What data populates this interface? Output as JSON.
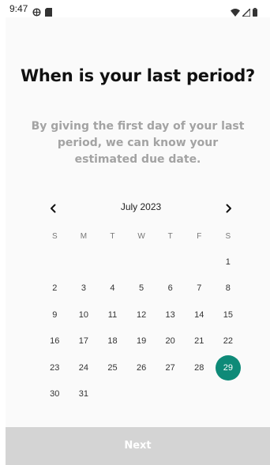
{
  "status_bar": {
    "time": "9:47",
    "left_icons": [
      "vpn-globe-icon",
      "sd-card-icon"
    ],
    "right_icons": [
      "wifi-icon",
      "cell-signal-icon",
      "battery-icon"
    ]
  },
  "onboarding": {
    "title": "When is your last period?",
    "subtitle": "By giving the first day of your last period, we can know your estimated due date."
  },
  "calendar": {
    "month_label": "July 2023",
    "prev_icon": "chevron-left-icon",
    "next_icon": "chevron-right-icon",
    "weekdays": [
      "S",
      "M",
      "T",
      "W",
      "T",
      "F",
      "S"
    ],
    "leading_blanks": 6,
    "days": [
      "1",
      "2",
      "3",
      "4",
      "5",
      "6",
      "7",
      "8",
      "9",
      "10",
      "11",
      "12",
      "13",
      "14",
      "15",
      "16",
      "17",
      "18",
      "19",
      "20",
      "21",
      "22",
      "23",
      "24",
      "25",
      "26",
      "27",
      "28",
      "29",
      "30",
      "31"
    ],
    "selected_day": "29",
    "accent_color": "#0e8a78"
  },
  "footer": {
    "next_label": "Next",
    "button_color": "#d4d4d4"
  }
}
